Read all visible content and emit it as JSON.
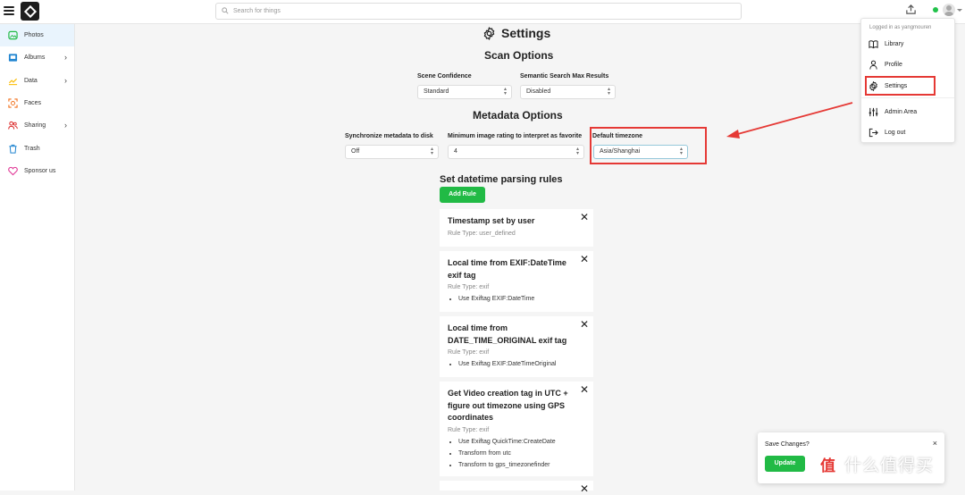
{
  "header": {
    "search_placeholder": "Search for things"
  },
  "sidebar": {
    "items": [
      {
        "label": "Photos",
        "icon": "photo-icon",
        "active": true,
        "color": "#21ba45"
      },
      {
        "label": "Albums",
        "icon": "album-icon",
        "chevron": true,
        "color": "#2185d0"
      },
      {
        "label": "Data",
        "icon": "chart-icon",
        "chevron": true,
        "color": "#fbbd08"
      },
      {
        "label": "Faces",
        "icon": "face-icon",
        "color": "#f2711c"
      },
      {
        "label": "Sharing",
        "icon": "users-icon",
        "chevron": true,
        "color": "#db2828"
      },
      {
        "label": "Trash",
        "icon": "trash-icon",
        "color": "#2185d0"
      },
      {
        "label": "Sponsor us",
        "icon": "heart-icon",
        "color": "#e03997"
      }
    ]
  },
  "main": {
    "title": "Settings",
    "scan_options": {
      "title": "Scan Options",
      "scene_confidence_label": "Scene Confidence",
      "scene_confidence_value": "Standard",
      "semantic_search_label": "Semantic Search Max Results",
      "semantic_search_value": "Disabled"
    },
    "metadata_options": {
      "title": "Metadata Options",
      "sync_label": "Synchronize metadata to disk",
      "sync_value": "Off",
      "min_rating_label": "Minimum image rating to interpret as favorite",
      "min_rating_value": "4",
      "timezone_label": "Default timezone",
      "timezone_value": "Asia/Shanghai"
    },
    "datetime_rules": {
      "title": "Set datetime parsing rules",
      "add_rule_label": "Add Rule",
      "rules": [
        {
          "title": "Timestamp set by user",
          "type": "Rule Type: user_defined",
          "details": []
        },
        {
          "title": "Local time from EXIF:DateTime exif tag",
          "type": "Rule Type: exif",
          "details": [
            "Use Exiftag EXIF:DateTime"
          ]
        },
        {
          "title": "Local time from DATE_TIME_ORIGINAL exif tag",
          "type": "Rule Type: exif",
          "details": [
            "Use Exiftag EXIF:DateTimeOriginal"
          ]
        },
        {
          "title": "Get Video creation tag in UTC + figure out timezone using GPS coordinates",
          "type": "Rule Type: exif",
          "details": [
            "Use Exiftag QuickTime:CreateDate",
            "Transform from utc",
            "Transform to gps_timezonefinder"
          ]
        }
      ]
    }
  },
  "user_menu": {
    "header": "Logged in as yangmouren",
    "items": {
      "library": "Library",
      "profile": "Profile",
      "settings": "Settings",
      "admin": "Admin Area",
      "logout": "Log out"
    }
  },
  "toast": {
    "title": "Save Changes?",
    "close": "×",
    "update_label": "Update"
  },
  "watermark": {
    "text": "什么值得买",
    "logo": "值"
  },
  "colors": {
    "accent_green": "#21ba45",
    "highlight_red": "#e53935",
    "status_online": "#21c24a"
  }
}
